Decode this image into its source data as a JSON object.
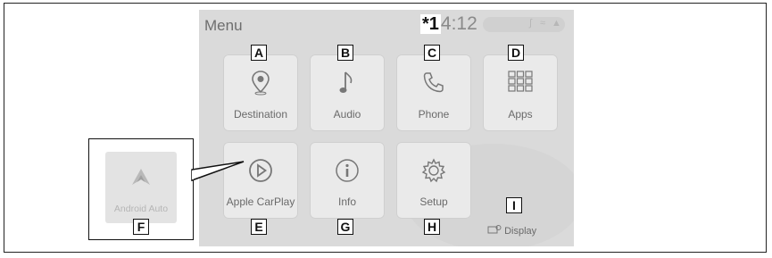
{
  "screen": {
    "menu_title": "Menu",
    "clock_marker": "*1",
    "clock_time": "4:12",
    "status_icons": [
      "bluetooth-icon",
      "wifi-icon",
      "signal-icon"
    ]
  },
  "tiles": [
    {
      "label": "Destination",
      "icon": "map-pin-icon",
      "callout": "A"
    },
    {
      "label": "Audio",
      "icon": "music-note-icon",
      "callout": "B"
    },
    {
      "label": "Phone",
      "icon": "phone-icon",
      "callout": "C"
    },
    {
      "label": "Apps",
      "icon": "grid-icon",
      "callout": "D"
    },
    {
      "label": "Apple CarPlay",
      "icon": "play-circle-icon",
      "callout": "E"
    },
    {
      "label": "Info",
      "icon": "info-icon",
      "callout": "G"
    },
    {
      "label": "Setup",
      "icon": "gear-icon",
      "callout": "H"
    }
  ],
  "display_button": {
    "label": "Display",
    "icon": "display-icon",
    "callout": "I"
  },
  "callout_box": {
    "label": "Android Auto",
    "icon": "android-auto-icon",
    "callout": "F"
  },
  "colors": {
    "screen_bg": "#dadada",
    "tile_bg": "#eaeaea",
    "badge_border": "#111111"
  }
}
